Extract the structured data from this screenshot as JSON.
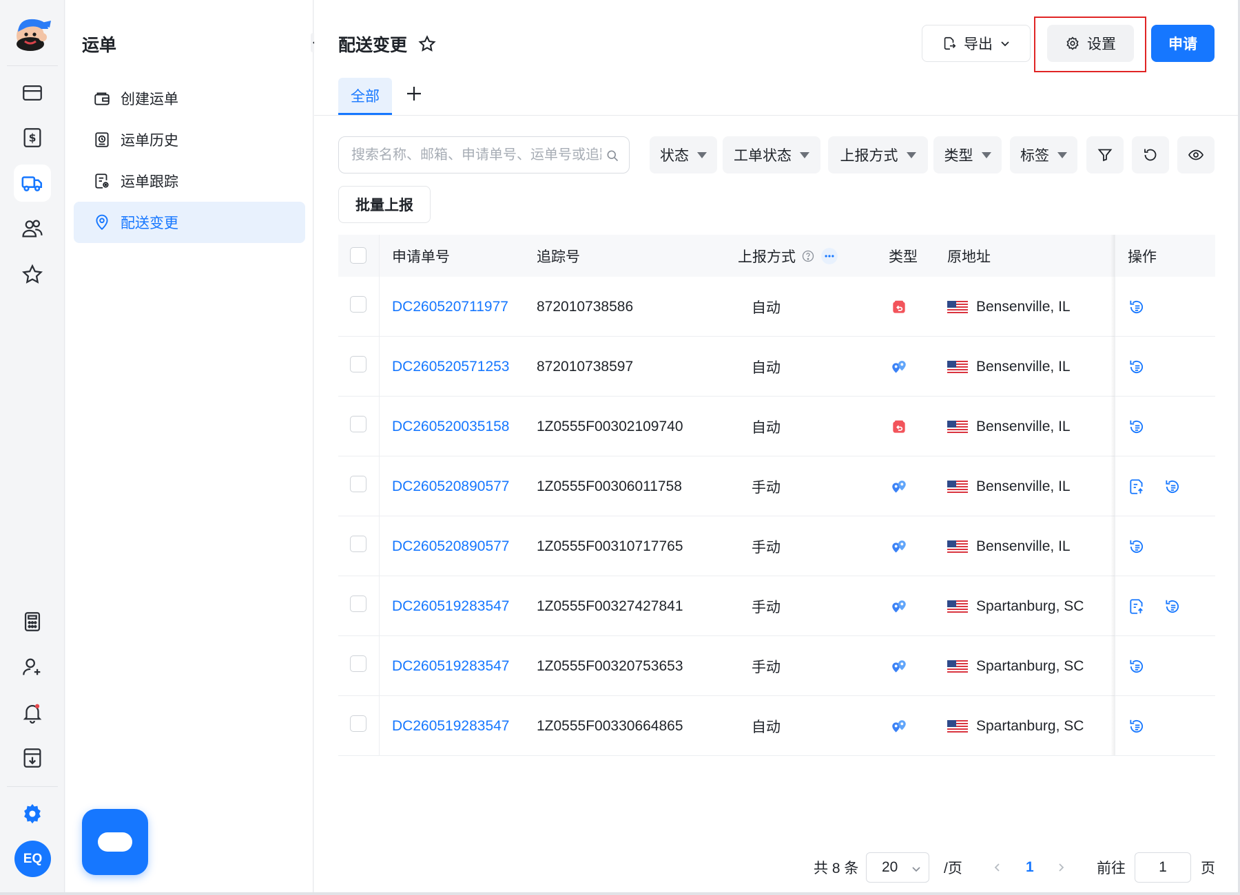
{
  "rail": {
    "items": [
      "card-icon",
      "dollar-doc-icon",
      "truck-icon",
      "users-icon",
      "star-icon"
    ],
    "bottom_items": [
      "calculator-icon",
      "add-user-icon",
      "bell-icon",
      "download-doc-icon"
    ],
    "avatar_text": "EQ"
  },
  "nav": {
    "title": "运单",
    "items": [
      {
        "label": "创建运单",
        "icon": "wallet-icon"
      },
      {
        "label": "运单历史",
        "icon": "history-doc-icon"
      },
      {
        "label": "运单跟踪",
        "icon": "track-doc-icon"
      },
      {
        "label": "配送变更",
        "icon": "location-icon",
        "active": true
      }
    ]
  },
  "header": {
    "title": "配送变更",
    "export_label": "导出",
    "settings_label": "设置",
    "apply_label": "申请"
  },
  "tabs": {
    "all_label": "全部"
  },
  "filters": {
    "search_placeholder": "搜索名称、邮箱、申请单号、运单号或追踪号",
    "status": "状态",
    "ticket_status": "工单状态",
    "report_method": "上报方式",
    "type": "类型",
    "tag": "标签",
    "batch_report": "批量上报"
  },
  "table": {
    "columns": {
      "request_no": "申请单号",
      "tracking_no": "追踪号",
      "report_method": "上报方式",
      "type": "类型",
      "origin": "原地址",
      "actions": "操作"
    },
    "rows": [
      {
        "request_no": "DC260520711977",
        "tracking_no": "872010738586",
        "method": "自动",
        "type": "return-icon",
        "origin": "Bensenville, IL",
        "actions": [
          "change-history-icon"
        ]
      },
      {
        "request_no": "DC260520571253",
        "tracking_no": "872010738597",
        "method": "自动",
        "type": "reroute-icon",
        "origin": "Bensenville, IL",
        "actions": [
          "change-history-icon"
        ]
      },
      {
        "request_no": "DC260520035158",
        "tracking_no": "1Z0555F00302109740",
        "method": "自动",
        "type": "return-icon",
        "origin": "Bensenville, IL",
        "actions": [
          "change-history-icon"
        ]
      },
      {
        "request_no": "DC260520890577",
        "tracking_no": "1Z0555F00306011758",
        "method": "手动",
        "type": "reroute-icon",
        "origin": "Bensenville, IL",
        "actions": [
          "upload-report-icon",
          "change-history-icon"
        ]
      },
      {
        "request_no": "DC260520890577",
        "tracking_no": "1Z0555F00310717765",
        "method": "手动",
        "type": "reroute-icon",
        "origin": "Bensenville, IL",
        "actions": [
          "change-history-icon"
        ]
      },
      {
        "request_no": "DC260519283547",
        "tracking_no": "1Z0555F00327427841",
        "method": "手动",
        "type": "reroute-icon",
        "origin": "Spartanburg, SC",
        "actions": [
          "upload-report-icon",
          "change-history-icon"
        ]
      },
      {
        "request_no": "DC260519283547",
        "tracking_no": "1Z0555F00320753653",
        "method": "手动",
        "type": "reroute-icon",
        "origin": "Spartanburg, SC",
        "actions": [
          "change-history-icon"
        ]
      },
      {
        "request_no": "DC260519283547",
        "tracking_no": "1Z0555F00330664865",
        "method": "自动",
        "type": "reroute-icon",
        "origin": "Spartanburg, SC",
        "actions": [
          "change-history-icon"
        ]
      }
    ]
  },
  "pagination": {
    "total_text": "共 8 条",
    "page_size": "20",
    "per_page_text": "/页",
    "current_page": "1",
    "goto_text": "前往",
    "goto_value": "1",
    "page_unit": "页"
  },
  "colors": {
    "accent": "#1677ff",
    "highlight": "#e02424",
    "return_type": "#f2545b"
  }
}
